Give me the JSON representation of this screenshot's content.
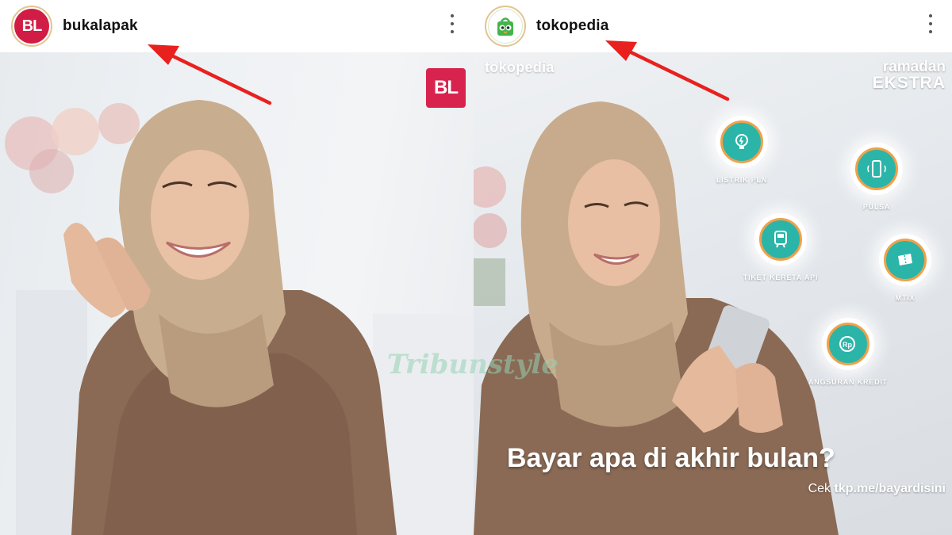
{
  "posts": [
    {
      "username": "bukalapak",
      "avatar_text": "BL",
      "image": {
        "brand_logo": "BL"
      }
    },
    {
      "username": "tokopedia",
      "avatar_icon": "tokopedia-bag-icon",
      "image": {
        "wordmark": "tokopedia",
        "campaign_line1": "ramadan",
        "campaign_line2": "EKSTRA",
        "services": [
          {
            "label": "LISTRIK PLN",
            "icon": "bulb-icon"
          },
          {
            "label": "PULSA",
            "icon": "phone-icon"
          },
          {
            "label": "TIKET KERETA API",
            "icon": "train-icon"
          },
          {
            "label": "MTIX",
            "icon": "ticket-icon"
          },
          {
            "label": "ANGSURAN KREDIT",
            "icon": "rupiah-coin-icon"
          }
        ],
        "headline": "Bayar apa di akhir bulan?",
        "cta_prefix": "Cek ",
        "cta_link": "tkp.me/bayardisini"
      }
    }
  ],
  "watermark": "Tribunstyle",
  "colors": {
    "bukalapak_red": "#d8234f",
    "tokopedia_green": "#42b549",
    "service_teal": "#2bb5a8",
    "service_ring": "#f0a14a",
    "arrow_red": "#e8211f"
  }
}
